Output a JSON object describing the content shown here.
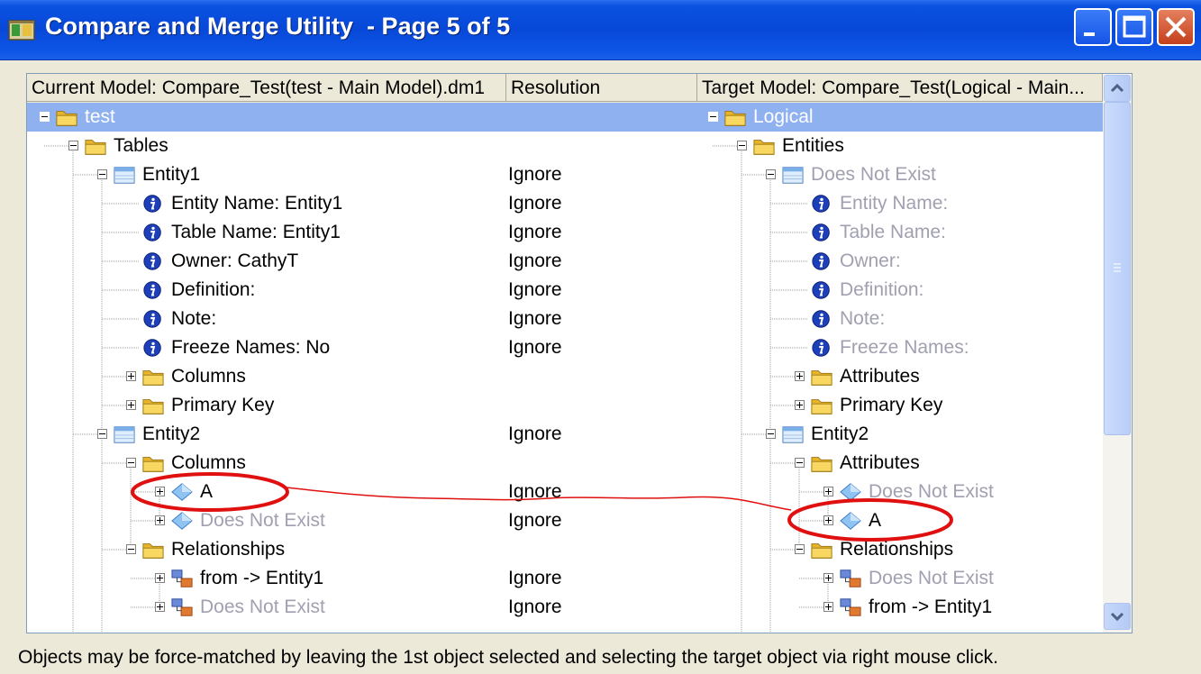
{
  "window": {
    "title": "Compare and Merge Utility  - Page 5 of 5"
  },
  "columns": {
    "current": "Current Model: Compare_Test(test - Main Model).dm1",
    "resolution": "Resolution",
    "target": "Target Model: Compare_Test(Logical - Main..."
  },
  "rows": [
    {
      "left": {
        "text": "test",
        "icon": "folder",
        "level": 0,
        "toggle": "minus"
      },
      "res": "",
      "right": {
        "text": "Logical",
        "icon": "folder",
        "level": 0,
        "toggle": "minus"
      },
      "selected": true
    },
    {
      "left": {
        "text": "Tables",
        "icon": "folder",
        "level": 1,
        "toggle": "minus"
      },
      "res": "",
      "right": {
        "text": "Entities",
        "icon": "folder",
        "level": 1,
        "toggle": "minus"
      }
    },
    {
      "left": {
        "text": "Entity1",
        "icon": "table",
        "level": 2,
        "toggle": "minus"
      },
      "res": "Ignore",
      "right": {
        "text": "Does Not Exist",
        "icon": "table",
        "level": 2,
        "toggle": "minus",
        "dim": true
      }
    },
    {
      "left": {
        "text": "Entity Name: Entity1",
        "icon": "info",
        "level": 3
      },
      "res": "Ignore",
      "right": {
        "text": "Entity Name:",
        "icon": "info",
        "level": 3,
        "dim": true
      }
    },
    {
      "left": {
        "text": "Table Name: Entity1",
        "icon": "info",
        "level": 3
      },
      "res": "Ignore",
      "right": {
        "text": "Table Name:",
        "icon": "info",
        "level": 3,
        "dim": true
      }
    },
    {
      "left": {
        "text": "Owner: CathyT",
        "icon": "info",
        "level": 3
      },
      "res": "Ignore",
      "right": {
        "text": "Owner:",
        "icon": "info",
        "level": 3,
        "dim": true
      }
    },
    {
      "left": {
        "text": "Definition:",
        "icon": "info",
        "level": 3
      },
      "res": "Ignore",
      "right": {
        "text": "Definition:",
        "icon": "info",
        "level": 3,
        "dim": true
      }
    },
    {
      "left": {
        "text": "Note:",
        "icon": "info",
        "level": 3
      },
      "res": "Ignore",
      "right": {
        "text": "Note:",
        "icon": "info",
        "level": 3,
        "dim": true
      }
    },
    {
      "left": {
        "text": "Freeze Names: No",
        "icon": "info",
        "level": 3
      },
      "res": "Ignore",
      "right": {
        "text": "Freeze Names:",
        "icon": "info",
        "level": 3,
        "dim": true
      }
    },
    {
      "left": {
        "text": "Columns",
        "icon": "folder",
        "level": 3,
        "toggle": "plus"
      },
      "res": "",
      "right": {
        "text": "Attributes",
        "icon": "folder",
        "level": 3,
        "toggle": "plus"
      }
    },
    {
      "left": {
        "text": "Primary Key",
        "icon": "folder",
        "level": 3,
        "toggle": "plus"
      },
      "res": "",
      "right": {
        "text": "Primary Key",
        "icon": "folder",
        "level": 3,
        "toggle": "plus"
      }
    },
    {
      "left": {
        "text": "Entity2",
        "icon": "table",
        "level": 2,
        "toggle": "minus"
      },
      "res": "Ignore",
      "right": {
        "text": "Entity2",
        "icon": "table",
        "level": 2,
        "toggle": "minus"
      }
    },
    {
      "left": {
        "text": "Columns",
        "icon": "folder",
        "level": 3,
        "toggle": "minus"
      },
      "res": "",
      "right": {
        "text": "Attributes",
        "icon": "folder",
        "level": 3,
        "toggle": "minus"
      }
    },
    {
      "left": {
        "text": "A",
        "icon": "diamond",
        "level": 4,
        "toggle": "plus"
      },
      "res": "Ignore",
      "right": {
        "text": "Does Not Exist",
        "icon": "diamond",
        "level": 4,
        "toggle": "plus",
        "dim": true
      }
    },
    {
      "left": {
        "text": "Does Not Exist",
        "icon": "diamond",
        "level": 4,
        "toggle": "plus",
        "dim": true
      },
      "res": "Ignore",
      "right": {
        "text": "A",
        "icon": "diamond",
        "level": 4,
        "toggle": "plus"
      }
    },
    {
      "left": {
        "text": "Relationships",
        "icon": "folder",
        "level": 3,
        "toggle": "minus"
      },
      "res": "",
      "right": {
        "text": "Relationships",
        "icon": "folder",
        "level": 3,
        "toggle": "minus"
      }
    },
    {
      "left": {
        "text": "from -> Entity1",
        "icon": "relation",
        "level": 4,
        "toggle": "plus"
      },
      "res": "Ignore",
      "right": {
        "text": "Does Not Exist",
        "icon": "relation",
        "level": 4,
        "toggle": "plus",
        "dim": true
      }
    },
    {
      "left": {
        "text": "Does Not Exist",
        "icon": "relation",
        "level": 4,
        "toggle": "plus",
        "dim": true
      },
      "res": "Ignore",
      "right": {
        "text": "from -> Entity1",
        "icon": "relation",
        "level": 4,
        "toggle": "plus"
      }
    }
  ],
  "status": "Objects may be force-matched by leaving the 1st object selected and selecting the target object via right mouse click.",
  "colors": {
    "selection": "#8fb1f0",
    "annotation": "#e01010",
    "dim_text": "#a0a0b0"
  }
}
